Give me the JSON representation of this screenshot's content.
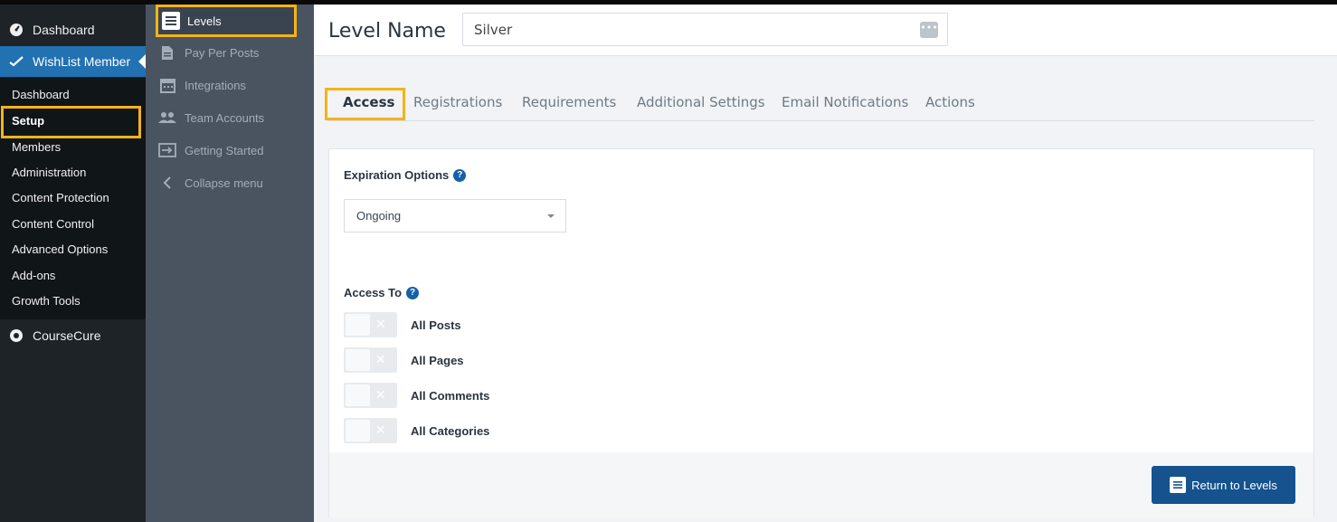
{
  "wp_menu": {
    "dashboard": "Dashboard",
    "wishlist": "WishList Member",
    "submenu": [
      "Dashboard",
      "Setup",
      "Members",
      "Administration",
      "Content Protection",
      "Content Control",
      "Advanced Options",
      "Add-ons",
      "Growth Tools"
    ],
    "coursecure": "CourseCure"
  },
  "plugin_menu": {
    "levels": "Levels",
    "items": [
      "Pay Per Posts",
      "Integrations",
      "Team Accounts",
      "Getting Started",
      "Collapse menu"
    ]
  },
  "header": {
    "title": "Level Name",
    "level_name_value": "Silver"
  },
  "tabs": [
    "Access",
    "Registrations",
    "Requirements",
    "Additional Settings",
    "Email Notifications",
    "Actions"
  ],
  "access": {
    "expiration_label": "Expiration Options",
    "expiration_value": "Ongoing",
    "access_to_label": "Access To",
    "toggles": [
      {
        "label": "All Posts",
        "on": false
      },
      {
        "label": "All Pages",
        "on": false
      },
      {
        "label": "All Comments",
        "on": false
      },
      {
        "label": "All Categories",
        "on": false
      }
    ]
  },
  "footer": {
    "return_label": "Return to Levels"
  },
  "colors": {
    "highlight": "#f4b31a",
    "primary": "#15528e",
    "wp_blue": "#2271b1"
  }
}
